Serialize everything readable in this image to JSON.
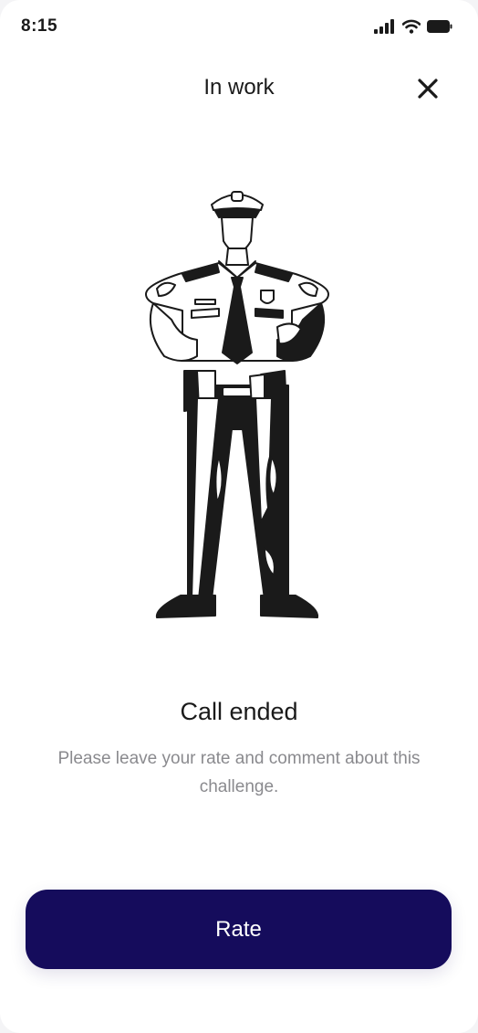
{
  "status_bar": {
    "time": "8:15"
  },
  "header": {
    "title": "In work",
    "close_icon": "close-icon"
  },
  "illustration": {
    "icon": "police-officer-illustration"
  },
  "content": {
    "headline": "Call ended",
    "message": "Please leave your rate and comment about this challenge."
  },
  "actions": {
    "rate_label": "Rate"
  },
  "colors": {
    "primary": "#150c5c",
    "text": "#1a1a1a",
    "muted": "#8a8a8e",
    "background": "#ffffff"
  }
}
